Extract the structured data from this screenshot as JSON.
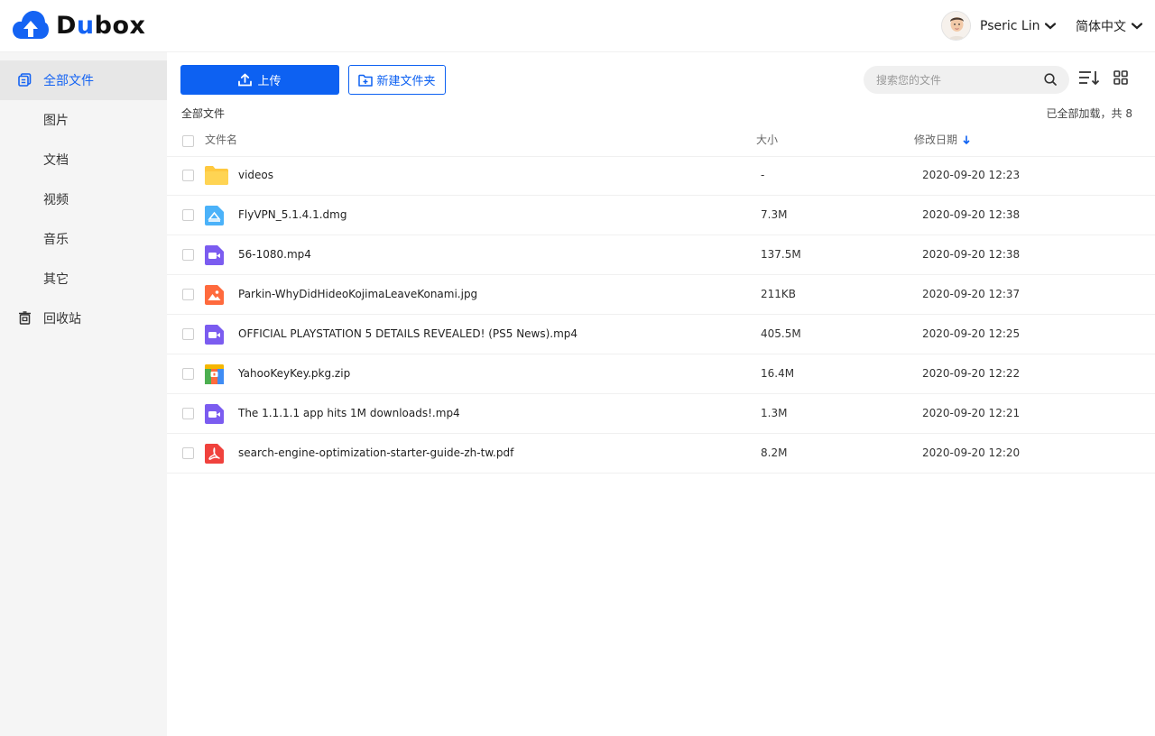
{
  "app": {
    "logo_text_pre": "D",
    "logo_text_u": "u",
    "logo_text_post": "box"
  },
  "header": {
    "user_name": "Pseric Lin",
    "language": "简体中文"
  },
  "sidebar": {
    "items": [
      {
        "label": "全部文件",
        "icon": "all-files-icon",
        "active": true
      },
      {
        "label": "图片"
      },
      {
        "label": "文档"
      },
      {
        "label": "视频"
      },
      {
        "label": "音乐"
      },
      {
        "label": "其它"
      },
      {
        "label": "回收站",
        "icon": "trash-icon"
      }
    ]
  },
  "toolbar": {
    "upload_label": "上传",
    "new_folder_label": "新建文件夹",
    "search_placeholder": "搜索您的文件"
  },
  "list": {
    "breadcrumb": "全部文件",
    "loaded_status": "已全部加载，共 8",
    "columns": {
      "name": "文件名",
      "size": "大小",
      "date": "修改日期"
    },
    "rows": [
      {
        "name": "videos",
        "size": "-",
        "date": "2020-09-20 12:23",
        "icon": "folder-icon",
        "color": "#FFC93F"
      },
      {
        "name": "FlyVPN_5.1.4.1.dmg",
        "size": "7.3M",
        "date": "2020-09-20 12:38",
        "icon": "disk-image-icon",
        "color": "#4BB2F9"
      },
      {
        "name": "56-1080.mp4",
        "size": "137.5M",
        "date": "2020-09-20 12:38",
        "icon": "video-file-icon",
        "color": "#7B5CF0"
      },
      {
        "name": "Parkin-WhyDidHideoKojimaLeaveKonami.jpg",
        "size": "211KB",
        "date": "2020-09-20 12:37",
        "icon": "image-file-icon",
        "color": "#FF6A3D"
      },
      {
        "name": "OFFICIAL PLAYSTATION 5 DETAILS REVEALED! (PS5 News).mp4",
        "size": "405.5M",
        "date": "2020-09-20 12:25",
        "icon": "video-file-icon",
        "color": "#7B5CF0"
      },
      {
        "name": "YahooKeyKey.pkg.zip",
        "size": "16.4M",
        "date": "2020-09-20 12:22",
        "icon": "archive-file-icon",
        "color": "#4CAF50"
      },
      {
        "name": "The 1.1.1.1 app hits 1M downloads!.mp4",
        "size": "1.3M",
        "date": "2020-09-20 12:21",
        "icon": "video-file-icon",
        "color": "#7B5CF0"
      },
      {
        "name": "search-engine-optimization-starter-guide-zh-tw.pdf",
        "size": "8.2M",
        "date": "2020-09-20 12:20",
        "icon": "pdf-file-icon",
        "color": "#F0423D"
      }
    ]
  },
  "colors": {
    "accent": "#0D61F2",
    "sidebar_bg": "#F5F5F5",
    "active_bg": "#E7E7E7"
  }
}
